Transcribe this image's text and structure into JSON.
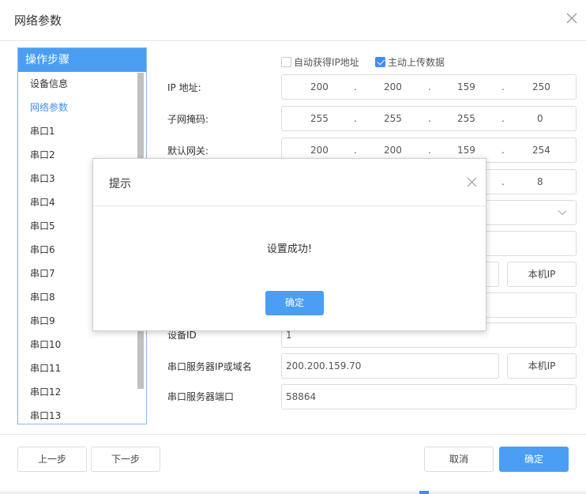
{
  "window": {
    "title": "网络参数"
  },
  "steps": {
    "header": "操作步骤",
    "items": [
      "设备信息",
      "网络参数",
      "串口1",
      "串口2",
      "串口3",
      "串口4",
      "串口5",
      "串口6",
      "串口7",
      "串口8",
      "串口9",
      "串口10",
      "串口11",
      "串口12",
      "串口13"
    ],
    "active_index": 1
  },
  "options": {
    "auto_ip": {
      "label": "自动获得IP地址",
      "checked": false
    },
    "auto_upload": {
      "label": "主动上传数据",
      "checked": true
    }
  },
  "form": {
    "ip": {
      "label": "IP 地址:",
      "octets": [
        "200",
        "200",
        "159",
        "250"
      ]
    },
    "mask": {
      "label": "子网掩码:",
      "octets": [
        "255",
        "255",
        "255",
        "0"
      ]
    },
    "gateway": {
      "label": "默认网关:",
      "octets": [
        "200",
        "200",
        "159",
        "254"
      ]
    },
    "dns": {
      "last_octet": "8"
    },
    "local_ip_button_1": "本机IP",
    "device_id": {
      "label": "设备ID",
      "value": "1"
    },
    "server_host": {
      "label": "串口服务器IP或域名",
      "value": "200.200.159.70",
      "button": "本机IP"
    },
    "server_port": {
      "label": "串口服务器端口",
      "value": "58864"
    }
  },
  "footer": {
    "prev": "上一步",
    "next": "下一步",
    "cancel": "取消",
    "ok": "确定"
  },
  "dialog": {
    "title": "提示",
    "message": "设置成功!",
    "ok": "确定"
  },
  "colors": {
    "accent": "#4a9ff5",
    "active_text": "#3e8ef7"
  }
}
